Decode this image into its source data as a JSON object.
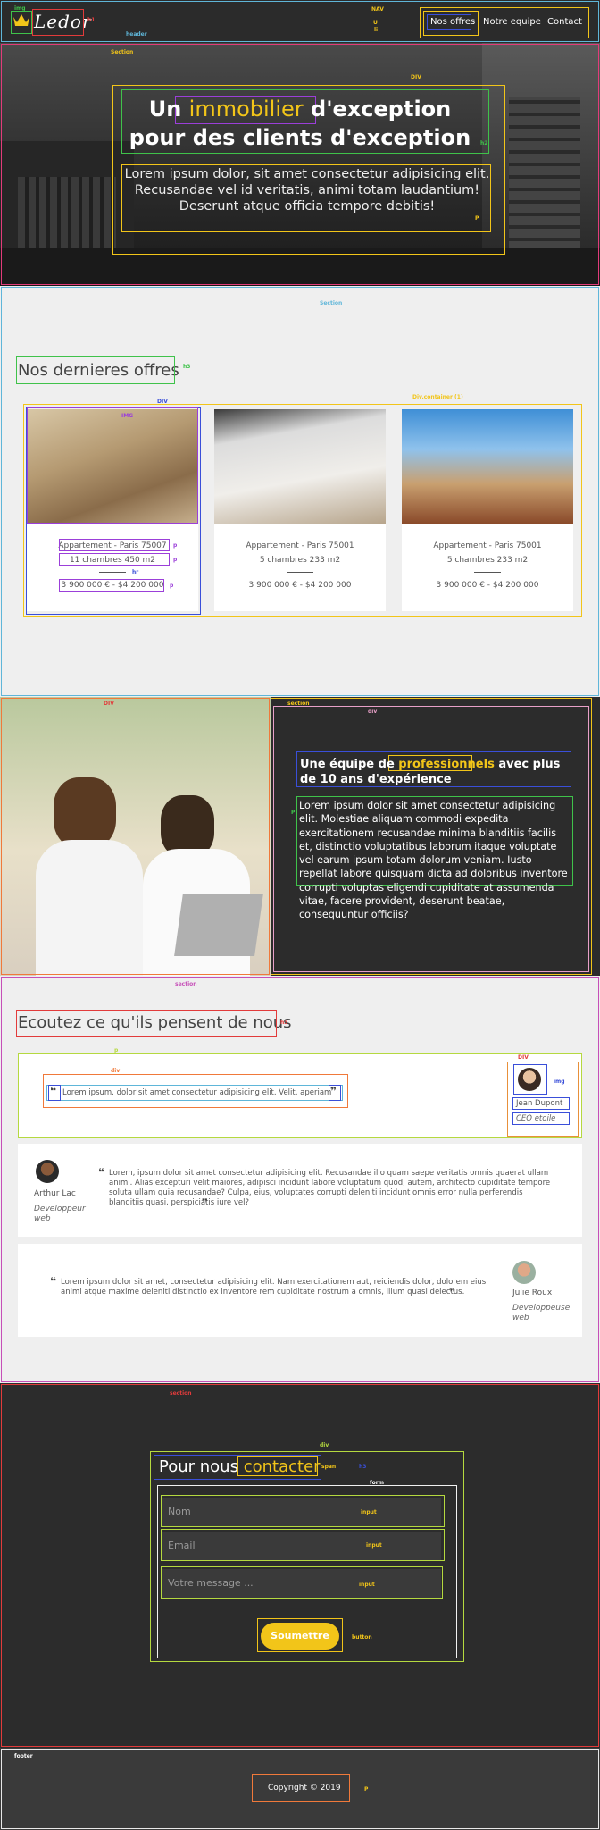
{
  "header": {
    "logo_text": "Ledor",
    "nav": [
      {
        "label": "Nos offres",
        "active": true
      },
      {
        "label": "Notre equipe",
        "active": false
      },
      {
        "label": "Contact",
        "active": false
      }
    ]
  },
  "hero": {
    "title_prefix": "Un",
    "title_accent": "immobilier",
    "title_rest": "d'exception pour des clients d'exception",
    "subtitle": "Lorem ipsum dolor, sit amet consectetur adipisicing elit. Recusandae vel id veritatis, animi totam laudantium! Deserunt atque officia tempore debitis!"
  },
  "offers": {
    "heading": "Nos dernieres offres",
    "cards": [
      {
        "title": "Appartement - Paris 75007",
        "rooms": "11 chambres 450 m2",
        "price": "3 900 000 € - $4 200 000"
      },
      {
        "title": "Appartement - Paris 75001",
        "rooms": "5 chambres 233 m2",
        "price": "3 900 000 € - $4 200 000"
      },
      {
        "title": "Appartement - Paris 75001",
        "rooms": "5 chambres 233 m2",
        "price": "3 900 000 € - $4 200 000"
      }
    ]
  },
  "team": {
    "heading_prefix": "Une équipe de",
    "heading_accent": "professionnels",
    "heading_rest": "avec plus de 10 ans d'expérience",
    "text": "Lorem ipsum dolor sit amet consectetur adipisicing elit. Molestiae aliquam commodi expedita exercitationem recusandae minima blanditiis facilis et, distinctio voluptatibus laborum itaque voluptate vel earum ipsum totam dolorum veniam. Iusto repellat labore quisquam dicta ad doloribus inventore corrupti voluptas eligendi cupiditate at assumenda vitae, facere provident, deserunt beatae, consequuntur officiis?"
  },
  "testimonials": {
    "heading": "Ecoutez ce qu'ils pensent de nous",
    "items": [
      {
        "quote": "Lorem ipsum, dolor sit amet consectetur adipisicing elit. Velit, aperiam",
        "name": "Jean Dupont",
        "role": "CEO etoile"
      },
      {
        "quote": "Lorem, ipsum dolor sit amet consectetur adipisicing elit. Recusandae illo quam saepe veritatis omnis quaerat ullam animi. Alias excepturi velit maiores, adipisci incidunt labore voluptatum quod, autem, architecto cupiditate tempore soluta ullam quia recusandae? Culpa, eius, voluptates corrupti deleniti incidunt omnis error nulla perferendis blanditiis quasi, perspiciatis iure vel?",
        "name": "Arthur Lac",
        "role": "Developpeur web"
      },
      {
        "quote": "Lorem ipsum dolor sit amet, consectetur adipisicing elit. Nam exercitationem aut, reiciendis dolor, dolorem eius animi atque maxime deleniti distinctio ex inventore rem cupiditate nostrum a omnis, illum quasi delectus.",
        "name": "Julie Roux",
        "role": "Developpeuse web"
      }
    ]
  },
  "contact": {
    "heading_prefix": "Pour nous",
    "heading_accent": "contacter",
    "name_placeholder": "Nom",
    "email_placeholder": "Email",
    "message_placeholder": "Votre message ...",
    "submit_label": "Soumettre"
  },
  "footer": {
    "copyright": "Copyright © 2019"
  },
  "annotations": {
    "logo": "h1",
    "nav": "NAV",
    "nav_ul": "U",
    "nav_li": "li",
    "header": "header",
    "hero_section": "Section",
    "hero_div": "DIV",
    "hero_h2": "h2",
    "hero_p": "P",
    "offers_section": "Section",
    "offers_h3": "h3",
    "card_div": "DIV",
    "container": "Div.container  (1)",
    "img": "IMG",
    "p": "p",
    "hr": "hr",
    "team_div": "DIV",
    "team_section": "section",
    "team_div2": "div",
    "team_span": "span",
    "team_h3": "h3",
    "team_p": "P",
    "testi_section": "section",
    "testi_h3": "h3",
    "testi_div": "DIV",
    "testi_div2": "div",
    "testi_p": "p",
    "testi_img": "img",
    "contact_section": "section",
    "contact_div": "div",
    "contact_span": "span",
    "contact_h3": "h3",
    "contact_form": "form",
    "input": "input",
    "button": "button",
    "footer_tag": "footer",
    "footer_p": "P"
  },
  "colors": {
    "accent": "#f2c519",
    "dark": "#2c2c2c",
    "light": "#efefef"
  }
}
